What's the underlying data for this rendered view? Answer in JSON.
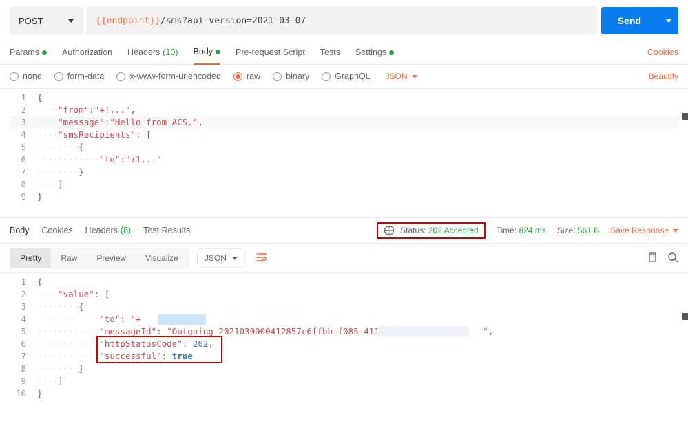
{
  "request": {
    "method": "POST",
    "url_var": "{{endpoint}}",
    "url_path": "/sms?api-version=2021-03-07",
    "send_label": "Send"
  },
  "tabs": {
    "params": "Params",
    "auth": "Authorization",
    "headers": "Headers",
    "headers_count": "(10)",
    "body": "Body",
    "prereq": "Pre-request Script",
    "tests": "Tests",
    "settings": "Settings",
    "cookies": "Cookies"
  },
  "body_types": {
    "none": "none",
    "formdata": "form-data",
    "urlencoded": "x-www-form-urlencoded",
    "raw": "raw",
    "binary": "binary",
    "graphql": "GraphQL",
    "json": "JSON",
    "beautify": "Beautify"
  },
  "req_body_text": {
    "from_key": "\"from\"",
    "from_val": "\"+!...\"",
    "message_key": "\"message\"",
    "message_val": "\"Hello from ACS.\"",
    "recipients_key": "\"smsRecipients\"",
    "to_key": "\"to\"",
    "to_val": "\"+1...\""
  },
  "response": {
    "tabs": {
      "body": "Body",
      "cookies": "Cookies",
      "headers": "Headers",
      "headers_count": "(8)",
      "results": "Test Results"
    },
    "status_label": "Status:",
    "status_value": "202 Accepted",
    "time_label": "Time:",
    "time_value": "824 ms",
    "size_label": "Size:",
    "size_value": "561 B",
    "save": "Save Response"
  },
  "resp_views": {
    "pretty": "Pretty",
    "raw": "Raw",
    "preview": "Preview",
    "visualize": "Visualize",
    "json": "JSON"
  },
  "resp_body_text": {
    "value_key": "\"value\"",
    "to_key": "\"to\"",
    "to_val": "\"+",
    "to_val2": "\"",
    "msgid_key": "\"messageId\"",
    "msgid_val_a": "\"Outgoing_2021030900412857c6ffbb-f085-411e-",
    "msgid_val_b": "\"",
    "httpcode_key": "\"httpStatusCode\"",
    "httpcode_val": "202",
    "success_key": "\"successful\"",
    "success_val": "true"
  }
}
